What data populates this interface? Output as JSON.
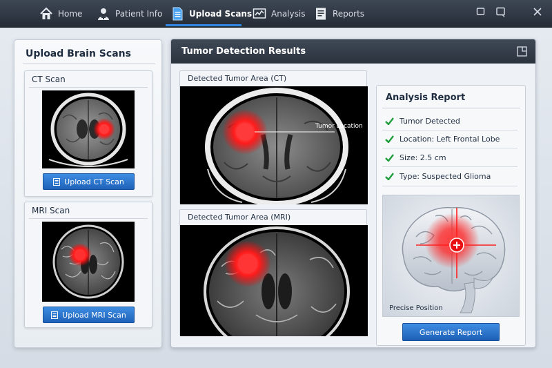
{
  "nav": {
    "items": [
      {
        "label": "Home",
        "icon": "home-icon"
      },
      {
        "label": "Patient Info",
        "icon": "user-doctor-icon"
      },
      {
        "label": "Upload Scans",
        "icon": "document-icon"
      },
      {
        "label": "Analysis",
        "icon": "chart-monitor-icon"
      },
      {
        "label": "Reports",
        "icon": "report-icon"
      }
    ],
    "active": "Upload Scans"
  },
  "window_controls": [
    "minimize-icon",
    "restore-icon",
    "close-icon"
  ],
  "left_panel": {
    "title": "Upload Brain Scans",
    "ct": {
      "label": "CT Scan",
      "button": "Upload CT Scan"
    },
    "mri": {
      "label": "MRI Scan",
      "button": "Upload MRI Scan"
    }
  },
  "main_panel": {
    "title": "Tumor Detection Results",
    "ct_result": {
      "label": "Detected Tumor Area (CT)",
      "annotation": "Tumor Location"
    },
    "mri_result": {
      "label": "Detected Tumor Area (MRI)"
    }
  },
  "report": {
    "title": "Analysis Report",
    "findings": [
      "Tumor Detected",
      "Location: Left Frontal Lobe",
      "Size: 2.5 cm",
      "Type: Suspected Glioma"
    ],
    "brain_caption": "Precise Position",
    "generate_button": "Generate Report"
  },
  "colors": {
    "accent": "#2f86e0",
    "button": "#1e62b8",
    "check": "#1f9d3a",
    "tumor": "#ff2a2a",
    "nav_bg": "#2a323d"
  }
}
